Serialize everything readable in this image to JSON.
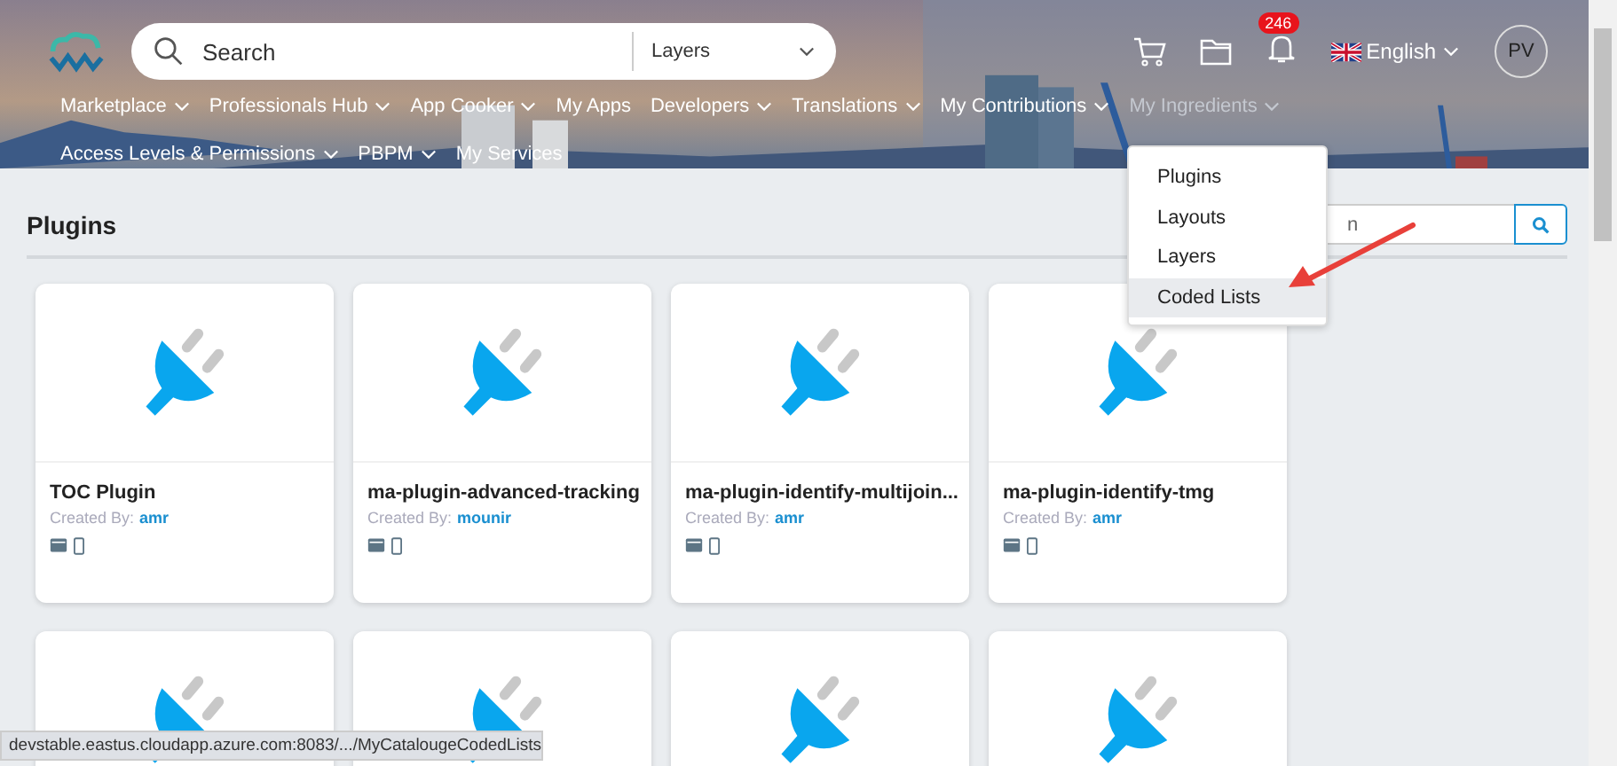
{
  "header": {
    "search": {
      "placeholder": "Search",
      "scope": "Layers"
    },
    "notifications": {
      "badge": "246"
    },
    "language": "English",
    "avatar": "PV"
  },
  "nav": [
    {
      "label": "Marketplace",
      "menu": true,
      "selected": false
    },
    {
      "label": "Professionals Hub",
      "menu": true,
      "selected": false
    },
    {
      "label": "App Cooker",
      "menu": true,
      "selected": false
    },
    {
      "label": "My Apps",
      "menu": false,
      "selected": false
    },
    {
      "label": "Developers",
      "menu": true,
      "selected": false
    },
    {
      "label": "Translations",
      "menu": true,
      "selected": false
    },
    {
      "label": "My Contributions",
      "menu": true,
      "selected": false
    },
    {
      "label": "My Ingredients",
      "menu": true,
      "selected": true
    },
    {
      "label": "Access Levels & Permissions",
      "menu": true,
      "selected": false
    },
    {
      "label": "PBPM",
      "menu": true,
      "selected": false
    },
    {
      "label": "My Services",
      "menu": false,
      "selected": false
    }
  ],
  "dropdown": [
    {
      "label": "Plugins",
      "selected": false
    },
    {
      "label": "Layouts",
      "selected": false
    },
    {
      "label": "Layers",
      "selected": false
    },
    {
      "label": "Coded Lists",
      "selected": true
    }
  ],
  "page": {
    "title": "Plugins",
    "search_placeholder": "n"
  },
  "cards": [
    {
      "kind": "plugin",
      "title": "TOC Plugin",
      "created_by_label": "Created By:",
      "author": "amr"
    },
    {
      "kind": "plugin",
      "title": "ma-plugin-advanced-tracking",
      "created_by_label": "Created By:",
      "author": "mounir"
    },
    {
      "kind": "plugin",
      "title": "ma-plugin-identify-multijoin...",
      "created_by_label": "Created By:",
      "author": "amr"
    },
    {
      "kind": "plugin",
      "title": "ma-plugin-identify-tmg",
      "created_by_label": "Created By:",
      "author": "amr"
    },
    {
      "kind": "plugin"
    },
    {
      "kind": "plugin"
    },
    {
      "kind": "plugin"
    },
    {
      "kind": "plugin"
    }
  ],
  "status_bar": "devstable.eastus.cloudapp.azure.com:8083/.../MyCatalougeCodedLists"
}
